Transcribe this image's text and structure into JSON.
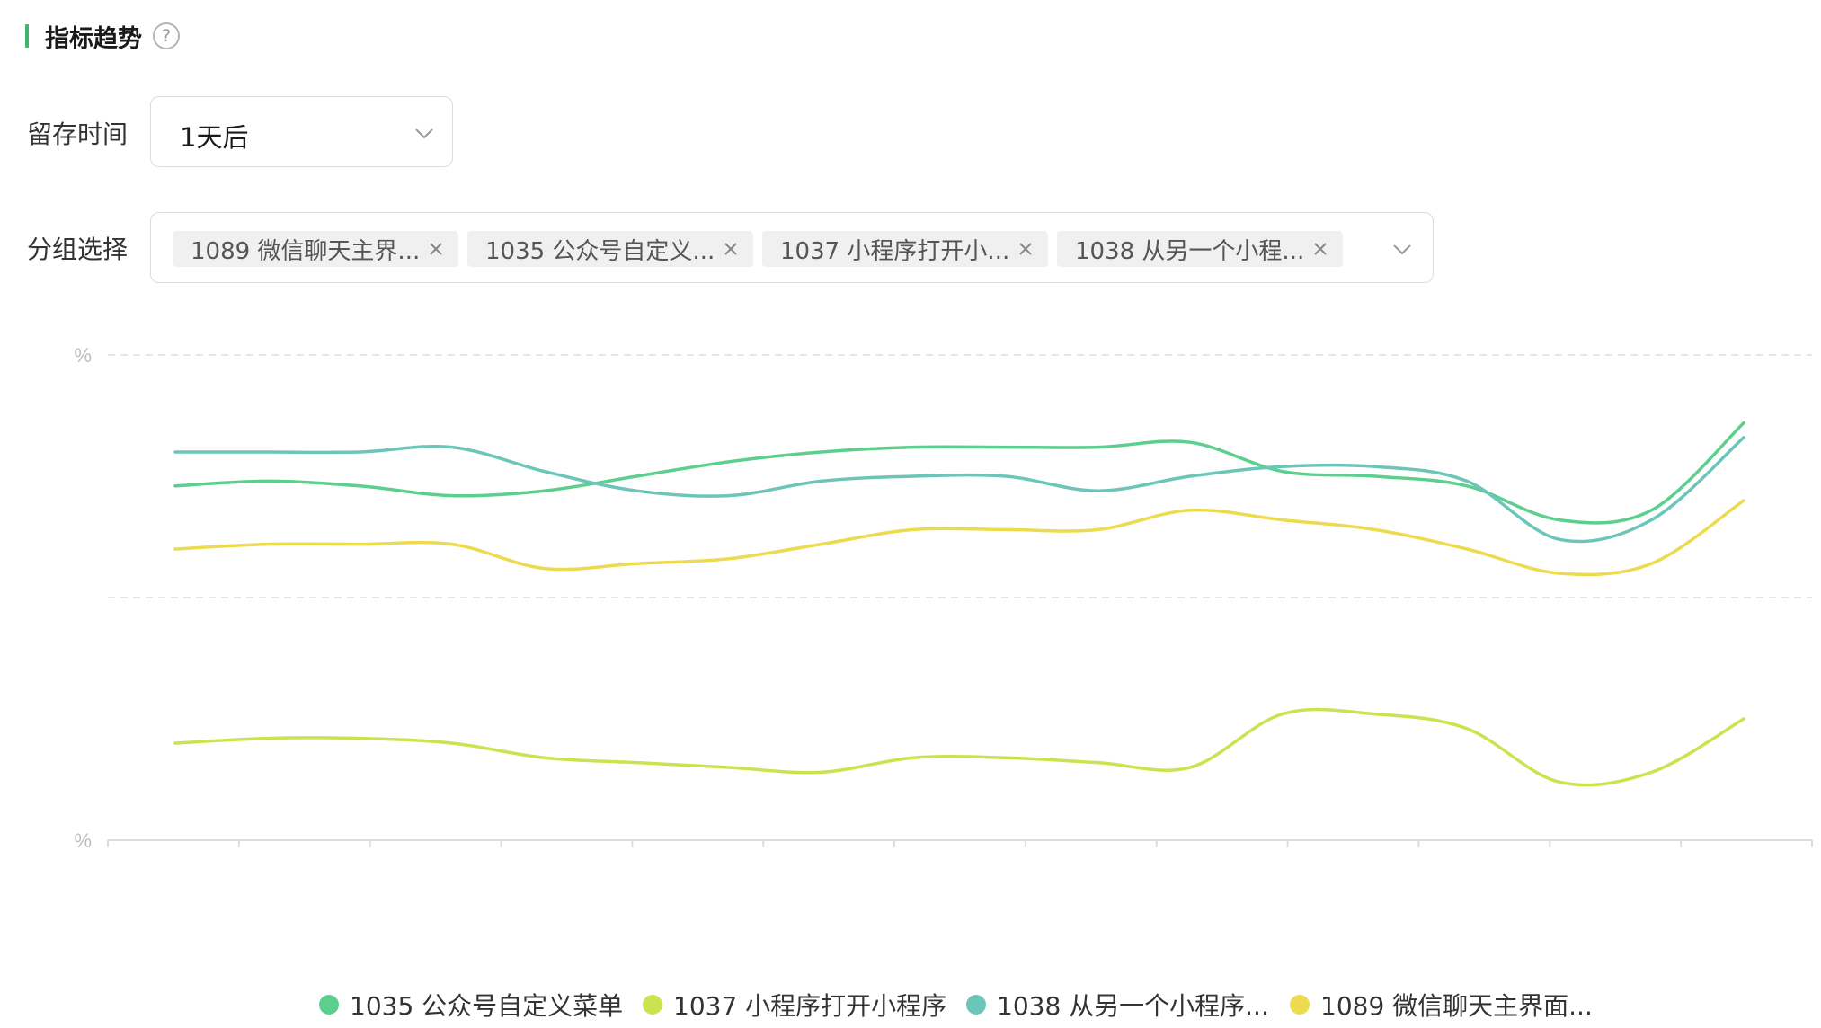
{
  "header": {
    "title": "指标趋势",
    "help_glyph": "?"
  },
  "retention": {
    "label": "留存时间",
    "value": "1天后"
  },
  "group": {
    "label": "分组选择",
    "tags": [
      {
        "label": "1089 微信聊天主界..."
      },
      {
        "label": "1035 公众号自定义..."
      },
      {
        "label": "1037 小程序打开小..."
      },
      {
        "label": "1038 从另一个小程..."
      }
    ]
  },
  "chart_data": {
    "type": "line",
    "y_tick_labels": [
      "%",
      "%"
    ],
    "grid": true,
    "legend_position": "bottom",
    "series": [
      {
        "name": "1035 公众号自定义菜单",
        "color": "#5ccf8e",
        "values": [
          73,
          74,
          73,
          71,
          72,
          75,
          78,
          80,
          81,
          81,
          81,
          82,
          76,
          75,
          73,
          66,
          68,
          86
        ]
      },
      {
        "name": "1037 小程序打开小程序",
        "color": "#c9e44f",
        "values": [
          20,
          21,
          21,
          20,
          17,
          16,
          15,
          14,
          17,
          17,
          16,
          15,
          26,
          26,
          23,
          12,
          14,
          25
        ]
      },
      {
        "name": "1038 从另一个小程序...",
        "color": "#6cc5b8",
        "values": [
          80,
          80,
          80,
          81,
          76,
          72,
          71,
          74,
          75,
          75,
          72,
          75,
          77,
          77,
          74,
          62,
          66,
          83
        ]
      },
      {
        "name": "1089 微信聊天主界面...",
        "color": "#ecdb4e",
        "values": [
          60,
          61,
          61,
          61,
          56,
          57,
          58,
          61,
          64,
          64,
          64,
          68,
          66,
          64,
          60,
          55,
          57,
          70
        ]
      }
    ]
  }
}
